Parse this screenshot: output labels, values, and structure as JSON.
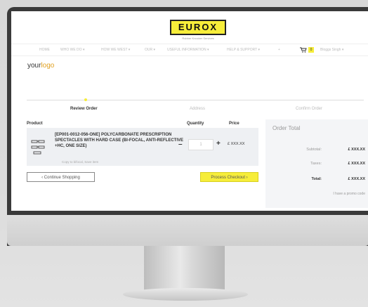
{
  "brand": {
    "name": "EUROX",
    "tagline": "Rubber Knocker Services",
    "site_logo_part1": "your",
    "site_logo_part2": "logo"
  },
  "nav": {
    "items": [
      "HOME",
      "WHO WE DO ▾",
      "HOW WE WEST ▾",
      "OUR ▾",
      "USEFUL INFORMATION ▾",
      "HELP & SUPPORT ▾",
      "+"
    ],
    "cart_count": "0",
    "user": "Bloggs Singh ▾"
  },
  "steps": [
    "Review Order",
    "Address",
    "Confirm Order"
  ],
  "table": {
    "headers": {
      "product": "Product",
      "quantity": "Quantity",
      "price": "Price"
    },
    "item": {
      "name": "[EP001-0012-056-ONE] POLYCARBONATE PRESCRIPTION SPECTACLES WITH HARD CASE (BI-FOCAL, ANTI-REFLECTIVE +HC, ONE SIZE)",
      "note": "Copy to bifocal, Save item",
      "qty": "1",
      "price": "£ XXX.XX",
      "minus": "–",
      "plus": "+"
    }
  },
  "buttons": {
    "continue": "‹ Continue Shopping",
    "checkout": "Process Checkout ›"
  },
  "summary": {
    "title": "Order Total",
    "rows": [
      {
        "label": "Subtotal:",
        "value": "£ XXX.XX"
      },
      {
        "label": "Taxes:",
        "value": "£ XXX.XX"
      },
      {
        "label": "Total:",
        "value": "£ XXX.XX"
      }
    ],
    "promo": "I have a promo code"
  },
  "colors": {
    "accent": "#f6ed3a",
    "bezel": "#3a3a3a"
  }
}
